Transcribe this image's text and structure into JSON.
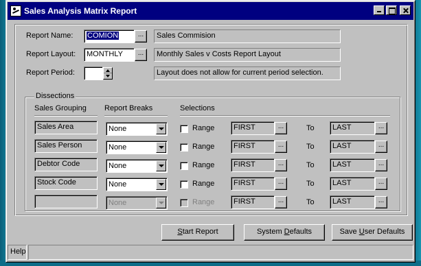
{
  "window": {
    "title": "Sales Analysis Matrix Report"
  },
  "report": {
    "name_label": "Report Name:",
    "name_value": "COMION",
    "name_desc": "Sales Commision",
    "layout_label": "Report Layout:",
    "layout_value": "MONTHLY",
    "layout_desc": "Monthly Sales v Costs Report Layout",
    "period_label": "Report Period:",
    "period_value": "",
    "period_msg": "Layout does not allow for current period selection.",
    "lookup_label": "..."
  },
  "dissections": {
    "title": "Dissections",
    "headers": {
      "grouping": "Sales Grouping",
      "breaks": "Report Breaks",
      "selections": "Selections"
    },
    "range_label": "Range",
    "to_label": "To",
    "rows": [
      {
        "grouping": "Sales Area",
        "break": "None",
        "from": "FIRST",
        "to": "LAST",
        "disabled": false
      },
      {
        "grouping": "Sales Person",
        "break": "None",
        "from": "FIRST",
        "to": "LAST",
        "disabled": false
      },
      {
        "grouping": "Debtor Code",
        "break": "None",
        "from": "FIRST",
        "to": "LAST",
        "disabled": false
      },
      {
        "grouping": "Stock Code",
        "break": "None",
        "from": "FIRST",
        "to": "LAST",
        "disabled": false
      },
      {
        "grouping": "",
        "break": "None",
        "from": "FIRST",
        "to": "LAST",
        "disabled": true
      }
    ]
  },
  "buttons": {
    "start_pre": "",
    "start_u": "S",
    "start_post": "tart Report",
    "defaults_pre": "System ",
    "defaults_u": "D",
    "defaults_post": "efaults",
    "save_pre": "Save ",
    "save_u": "U",
    "save_post": "ser Defaults"
  },
  "status": {
    "help": "Help"
  }
}
